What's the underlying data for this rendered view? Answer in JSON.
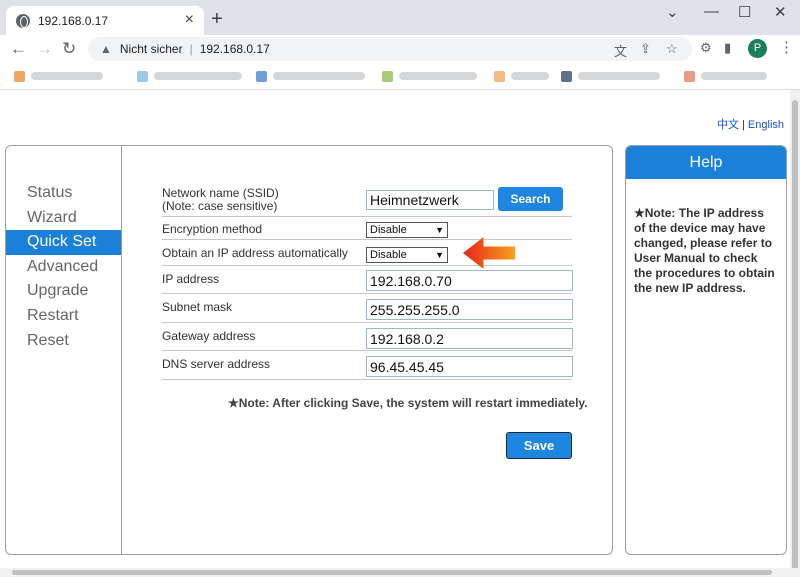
{
  "browser": {
    "tab_title": "192.168.0.17",
    "tab_close": "×",
    "new_tab": "+",
    "address_warning": "Nicht sicher",
    "address_url": "192.168.0.17",
    "avatar_letter": "P"
  },
  "page": {
    "lang_chinese": "中文",
    "lang_separator": "|",
    "lang_english": "English",
    "menu": [
      {
        "label": "Status"
      },
      {
        "label": "Wizard"
      },
      {
        "label": "Quick Set",
        "active": true
      },
      {
        "label": "Advanced"
      },
      {
        "label": "Upgrade"
      },
      {
        "label": "Restart"
      },
      {
        "label": "Reset"
      }
    ],
    "form": {
      "ssid_label": "Network name (SSID)",
      "ssid_note": "(Note: case sensitive)",
      "ssid_value": "Heimnetzwerk",
      "search_button": "Search",
      "encryption_label": "Encryption method",
      "encryption_value": "Disable",
      "dhcp_label": "Obtain an IP address automatically",
      "dhcp_value": "Disable",
      "ip_label": "IP address",
      "ip_value": "192.168.0.70",
      "subnet_label": "Subnet mask",
      "subnet_value": "255.255.255.0",
      "gateway_label": "Gateway address",
      "gateway_value": "192.168.0.2",
      "dns_label": "DNS server address",
      "dns_value": "96.45.45.45",
      "note": "★Note: After clicking Save, the system will restart immediately.",
      "save_button": "Save"
    },
    "help": {
      "title": "Help",
      "text": "★Note: The IP address of the device may have changed, please refer to User Manual to check the procedures to obtain the new IP address."
    }
  },
  "colors": {
    "accent": "#1a80d9",
    "arrow_start": "#e8241b",
    "arrow_end": "#f7a21b"
  }
}
